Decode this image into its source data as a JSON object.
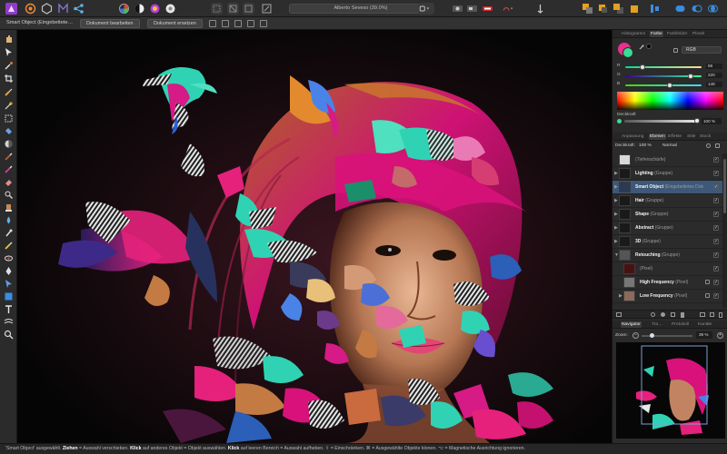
{
  "window": {
    "document_title": "Alberto Seveso (39.0%)"
  },
  "context_bar": {
    "selection_label": "Smart Object (Eingebettete…",
    "edit_document_button": "Dokument bearbeiten",
    "replace_document_button": "Dokument ersetzen"
  },
  "status_bar": {
    "prefix": "'Smart Object' ausgewählt.",
    "drag_bold": "Ziehen",
    "drag_text": "= Auswahl verschieben.",
    "click_bold": "Klick",
    "click_text": "auf anderes Objekt = Objekt auswählen.",
    "click2_bold": "Klick",
    "click2_text": "auf leeren Bereich = Auswahl aufheben.",
    "modifier1": "⇧ = Einschränken.",
    "modifier2": "⌘ = Ausgewählte Objekte klonen.",
    "modifier3": "⌥ = Magnetische Ausrichtung ignorieren."
  },
  "color_panel": {
    "tabs": [
      "Histogramm",
      "Farbe",
      "Farbfelder",
      "Pinsel"
    ],
    "active_tab": "Farbe",
    "mode": "RGB",
    "r_label": "R",
    "r_value": "59",
    "g_label": "G",
    "g_value": "220",
    "b_label": "B",
    "b_value": "148",
    "r_fraction": 0.23,
    "g_fraction": 0.86,
    "b_fraction": 0.58,
    "opacity_label": "Deckkraft",
    "opacity_value": "100 %",
    "primary_color": "#3bdc94"
  },
  "layers_panel": {
    "tabs": [
      "Anpassung",
      "Ebenen",
      "Effekte",
      "Stile",
      "Stock"
    ],
    "active_tab": "Ebenen",
    "opacity_label": "Deckkraft:",
    "opacity_value": "100 %",
    "blend_mode": "Normal",
    "layers": [
      {
        "name": "",
        "kind": "(Tiefenschärfe)",
        "expand": ""
      },
      {
        "name": "Lighting",
        "kind": "(Gruppe)",
        "expand": "▶"
      },
      {
        "name": "Smart Object",
        "kind": "(Eingebettetes Dok",
        "expand": "▶"
      },
      {
        "name": "Hair",
        "kind": "(Gruppe)",
        "expand": "▶"
      },
      {
        "name": "Shape",
        "kind": "(Gruppe)",
        "expand": "▶"
      },
      {
        "name": "Abstract",
        "kind": "(Gruppe)",
        "expand": "▶"
      },
      {
        "name": "3D",
        "kind": "(Gruppe)",
        "expand": "▶"
      },
      {
        "name": "Retouching",
        "kind": "(Gruppe)",
        "expand": "▼"
      },
      {
        "name": "",
        "kind": "(Pixel)",
        "expand": ""
      },
      {
        "name": "High Frequency",
        "kind": "(Pixel)",
        "expand": ""
      },
      {
        "name": "Low Frequency",
        "kind": "(Pixel)",
        "expand": "▶"
      }
    ],
    "check_mark": "✓"
  },
  "navigator_panel": {
    "tabs": [
      "Navigator",
      "Tra…",
      "Protokoll",
      "Kanäle"
    ],
    "active_tab": "Navigator",
    "zoom_label": "Zoom:",
    "zoom_value": "39 %",
    "zoom_fraction": 0.2,
    "minus_glyph": "−",
    "plus_glyph": "+"
  },
  "colors": {
    "accent_selection": "#3d5879",
    "magenta": "#d8127a",
    "teal": "#2fd3b4"
  }
}
